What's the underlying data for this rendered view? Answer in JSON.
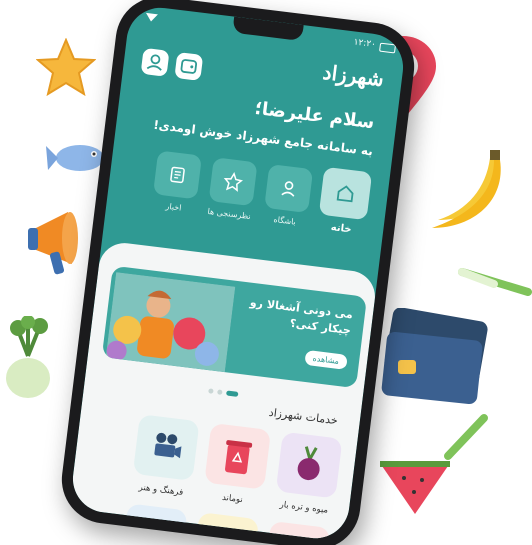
{
  "status_bar": {
    "time": "۱۲:۲۰"
  },
  "header": {
    "logo": "شهرزاد",
    "profile_icon": "user-icon",
    "wallet_icon": "wallet-icon"
  },
  "greeting": {
    "title": "سلام علیرضا؛",
    "subtitle": "به سامانه جامع شهرزاد خوش اومدی!"
  },
  "quick_nav": [
    {
      "label": "خانه",
      "icon": "home-icon",
      "active": true
    },
    {
      "label": "باشگاه",
      "icon": "user-icon",
      "active": false
    },
    {
      "label": "نظرسنجی ها",
      "icon": "star-icon",
      "active": false
    },
    {
      "label": "اخبار",
      "icon": "news-icon",
      "active": false
    }
  ],
  "banner": {
    "title_line1": "می دونی آشغالا رو",
    "title_line2": "چیکار کنی؟",
    "button_label": "مشاهده"
  },
  "services": {
    "title": "خدمات شهرزاد",
    "items": [
      {
        "label": "میوه و تره بار",
        "icon": "beet-icon",
        "color": "#ece3f5"
      },
      {
        "label": "نوماند",
        "icon": "bin-icon",
        "color": "#fbe4e4"
      },
      {
        "label": "فرهنگ و هنر",
        "icon": "camera-icon",
        "color": "#e2f1f1"
      }
    ]
  },
  "colors": {
    "primary": "#2f9a93",
    "accent": "#3ea79f",
    "sheet": "#f4f6f6"
  }
}
